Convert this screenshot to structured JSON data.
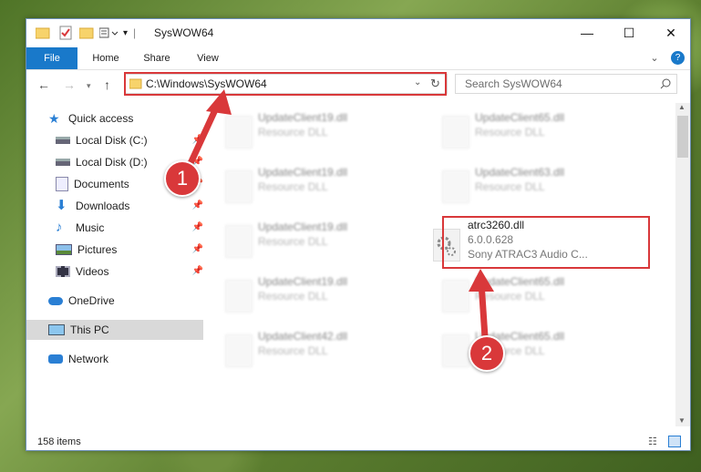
{
  "window": {
    "title": "SysWOW64",
    "controls": {
      "minimize": "—",
      "maximize": "☐",
      "close": "✕"
    }
  },
  "ribbon": {
    "tabs": [
      "File",
      "Home",
      "Share",
      "View"
    ],
    "help": "?",
    "expand": "⌄"
  },
  "nav": {
    "address": "C:\\Windows\\SysWOW64",
    "search_placeholder": "Search SysWOW64"
  },
  "sidebar": {
    "items": [
      {
        "label": "Quick access",
        "icon": "star-icon"
      },
      {
        "label": "Local Disk (C:)",
        "icon": "drive-icon",
        "pinned": true
      },
      {
        "label": "Local Disk (D:)",
        "icon": "drive-icon",
        "pinned": true
      },
      {
        "label": "Documents",
        "icon": "documents-icon",
        "pinned": true
      },
      {
        "label": "Downloads",
        "icon": "downloads-icon",
        "pinned": true
      },
      {
        "label": "Music",
        "icon": "music-icon",
        "pinned": true
      },
      {
        "label": "Pictures",
        "icon": "pictures-icon",
        "pinned": true
      },
      {
        "label": "Videos",
        "icon": "videos-icon",
        "pinned": true
      },
      {
        "label": "OneDrive",
        "icon": "cloud-icon"
      },
      {
        "label": "This PC",
        "icon": "computer-icon",
        "selected": true
      },
      {
        "label": "Network",
        "icon": "network-icon"
      }
    ]
  },
  "files": {
    "left": [
      {
        "name": "UpdateClient19.dll",
        "sub": "Resource DLL"
      },
      {
        "name": "UpdateClient19.dll",
        "sub": "Resource DLL"
      },
      {
        "name": "UpdateClient19.dll",
        "sub": "Resource DLL"
      },
      {
        "name": "UpdateClient19.dll",
        "sub": "Resource DLL"
      },
      {
        "name": "UpdateClient42.dll",
        "sub": "Resource DLL"
      }
    ],
    "right": [
      {
        "name": "UpdateClient65.dll",
        "sub": "Resource DLL"
      },
      {
        "name": "UpdateClient63.dll",
        "sub": "Resource DLL"
      },
      {
        "name": "atrc3260.dll",
        "sub": "6.0.0.628",
        "sub2": "Sony ATRAC3 Audio C...",
        "highlight": true
      },
      {
        "name": "UpdateClient65.dll",
        "sub": "Resource DLL"
      },
      {
        "name": "UpdateClient65.dll",
        "sub": "Resource DLL"
      }
    ]
  },
  "status": {
    "count": "158 items"
  },
  "annotations": {
    "badge1": "1",
    "badge2": "2"
  },
  "colors": {
    "accent": "#1979ca",
    "annotation": "#d9383a"
  }
}
